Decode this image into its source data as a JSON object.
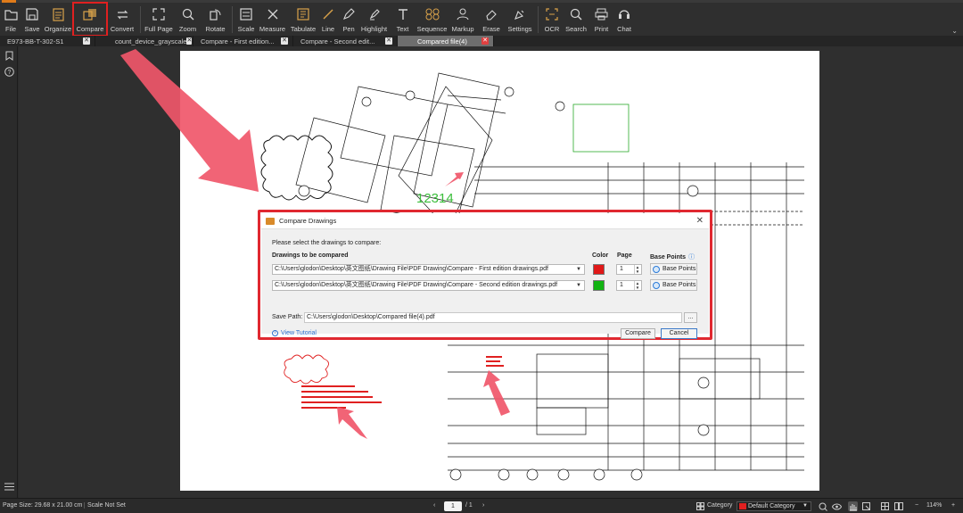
{
  "toolbar": {
    "items": [
      {
        "label": "File",
        "icon": "folder-icon"
      },
      {
        "label": "Save",
        "icon": "save-icon"
      },
      {
        "label": "Organize",
        "icon": "organize-icon"
      },
      {
        "label": "Compare",
        "icon": "compare-icon"
      },
      {
        "label": "Convert",
        "icon": "convert-icon"
      },
      {
        "label": "Full Page",
        "icon": "full-page-icon"
      },
      {
        "label": "Zoom",
        "icon": "zoom-icon"
      },
      {
        "label": "Rotate",
        "icon": "rotate-icon"
      },
      {
        "label": "Scale",
        "icon": "scale-icon"
      },
      {
        "label": "Measure",
        "icon": "measure-icon"
      },
      {
        "label": "Tabulate",
        "icon": "tabulate-icon"
      },
      {
        "label": "Line",
        "icon": "line-icon"
      },
      {
        "label": "Pen",
        "icon": "pen-icon"
      },
      {
        "label": "Highlight",
        "icon": "highlight-icon"
      },
      {
        "label": "Text",
        "icon": "text-icon"
      },
      {
        "label": "Sequence",
        "icon": "sequence-icon"
      },
      {
        "label": "Markup",
        "icon": "markup-icon"
      },
      {
        "label": "Erase",
        "icon": "erase-icon"
      },
      {
        "label": "Settings",
        "icon": "settings-icon"
      },
      {
        "label": "OCR",
        "icon": "ocr-icon"
      },
      {
        "label": "Search",
        "icon": "search-icon"
      },
      {
        "label": "Print",
        "icon": "print-icon"
      },
      {
        "label": "Chat",
        "icon": "chat-icon"
      }
    ],
    "accent": "#e02020"
  },
  "tabs": [
    {
      "label": "E973-BB-T-302-S1",
      "active": false
    },
    {
      "label": "count_device_grayscale",
      "active": false
    },
    {
      "label": "Compare - First edition...",
      "active": false
    },
    {
      "label": "Compare - Second edit...",
      "active": false
    },
    {
      "label": "Compared file(4)",
      "active": true
    }
  ],
  "drawing": {
    "cloud_label": "12314"
  },
  "dialog": {
    "title": "Compare Drawings",
    "prompt": "Please select the drawings to compare:",
    "headers": {
      "drawings": "Drawings to be compared",
      "color": "Color",
      "page": "Page",
      "base_points": "Base Points"
    },
    "rows": [
      {
        "file": "C:\\Users\\glodon\\Desktop\\英文图纸\\Drawing File\\PDF Drawing\\Compare - First edition drawings.pdf",
        "color": "#e01818",
        "page": "1",
        "base_points_label": "Base Points"
      },
      {
        "file": "C:\\Users\\glodon\\Desktop\\英文图纸\\Drawing File\\PDF Drawing\\Compare - Second edition drawings.pdf",
        "color": "#12b312",
        "page": "1",
        "base_points_label": "Base Points"
      }
    ],
    "save_path_label": "Save Path:",
    "save_path_value": "C:\\Users\\glodon\\Desktop\\Compared file(4).pdf",
    "browse_label": "...",
    "tutorial_label": "View Tutorial",
    "compare_label": "Compare",
    "cancel_label": "Cancel"
  },
  "status": {
    "page_size": "Page Size: 29.68 x 21.00 cm",
    "scale": "Scale Not Set",
    "current_page": "1",
    "page_total": "/ 1",
    "category_label": "Category",
    "category_value": "Default Category",
    "zoom": "114%"
  }
}
